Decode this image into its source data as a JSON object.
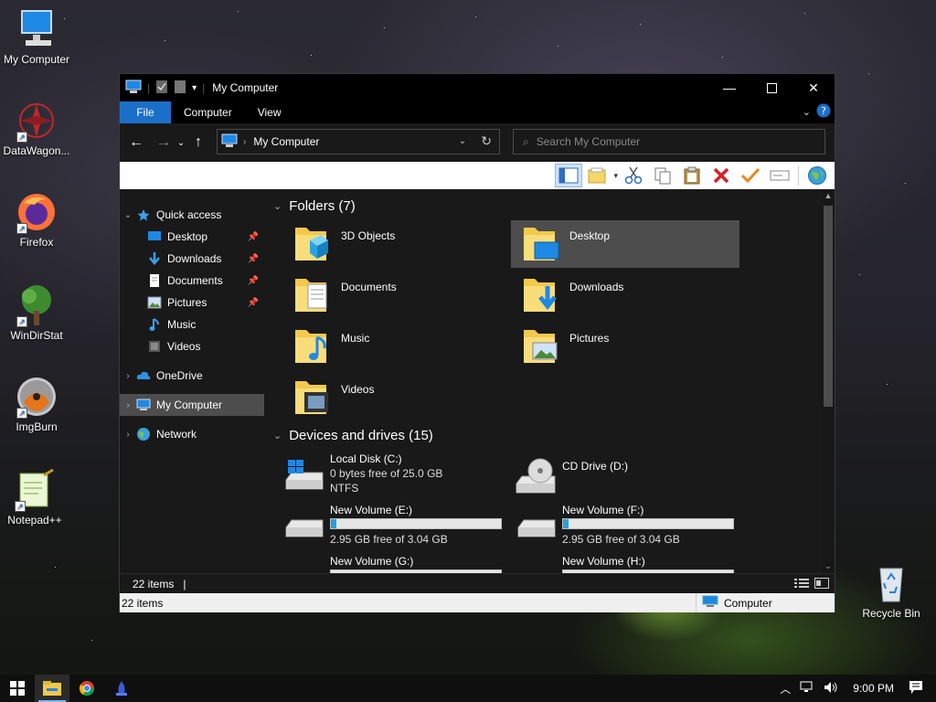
{
  "desktop": {
    "icons": [
      {
        "label": "My Computer"
      },
      {
        "label": "DataWagon..."
      },
      {
        "label": "Firefox"
      },
      {
        "label": "WinDirStat"
      },
      {
        "label": "ImgBurn"
      },
      {
        "label": "Notepad++"
      },
      {
        "label": "Recycle Bin"
      }
    ]
  },
  "window": {
    "title": "My Computer",
    "ribbon_tabs": [
      "File",
      "Computer",
      "View"
    ],
    "address": "My Computer",
    "search_placeholder": "Search My Computer",
    "nav": {
      "quick_access": "Quick access",
      "desktop": "Desktop",
      "downloads": "Downloads",
      "documents": "Documents",
      "pictures": "Pictures",
      "music": "Music",
      "videos": "Videos",
      "onedrive": "OneDrive",
      "my_computer": "My Computer",
      "network": "Network"
    },
    "folders_header": "Folders (7)",
    "folders": [
      {
        "name": "3D Objects"
      },
      {
        "name": "Desktop"
      },
      {
        "name": "Documents"
      },
      {
        "name": "Downloads"
      },
      {
        "name": "Music"
      },
      {
        "name": "Pictures"
      },
      {
        "name": "Videos"
      }
    ],
    "devices_header": "Devices and drives (15)",
    "drives": [
      {
        "name": "Local Disk (C:)",
        "free": "0 bytes free of 25.0 GB",
        "fs": "NTFS"
      },
      {
        "name": "CD Drive (D:)"
      },
      {
        "name": "New Volume (E:)",
        "free": "2.95 GB free of 3.04 GB",
        "used_fraction": 0.03
      },
      {
        "name": "New Volume (F:)",
        "free": "2.95 GB free of 3.04 GB",
        "used_fraction": 0.03
      },
      {
        "name": "New Volume (G:)"
      },
      {
        "name": "New Volume (H:)"
      }
    ],
    "status_count": "22 items",
    "status_count2": "22 items",
    "status_location": "Computer"
  },
  "taskbar": {
    "clock": "9:00 PM"
  },
  "colors": {
    "accent": "#1b6fc9",
    "selection": "#4d4d4d",
    "drive_fill": "#26a0da"
  }
}
